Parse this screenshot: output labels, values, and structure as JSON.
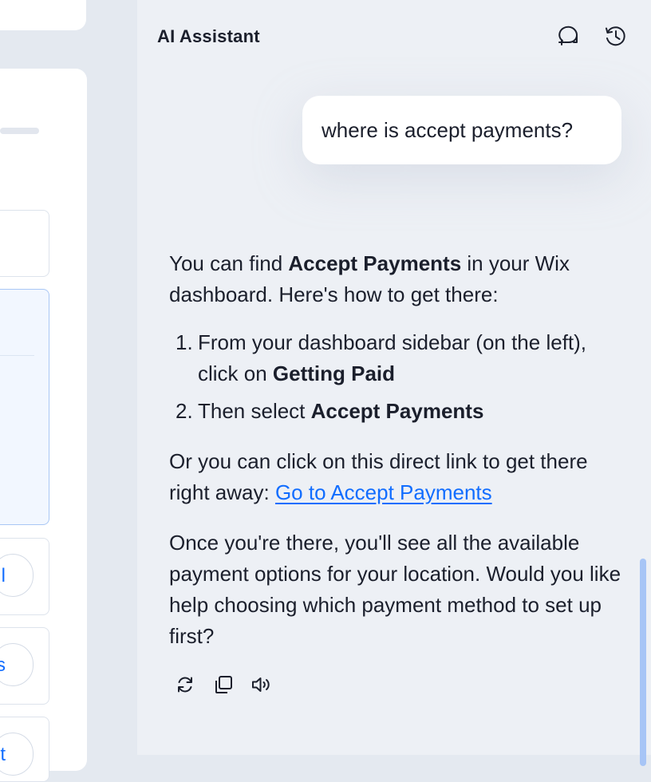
{
  "assistant": {
    "title": "AI Assistant",
    "icons": {
      "new_chat": "new-chat-icon",
      "history": "history-icon"
    }
  },
  "left_pane": {
    "pill_1_text": "l",
    "pill_2_text": "s",
    "pill_3_text": "t"
  },
  "conversation": {
    "user_message": "where is accept payments?",
    "answer": {
      "intro_before": "You can find ",
      "intro_bold": "Accept Payments",
      "intro_after": " in your Wix dashboard. Here's how to get there:",
      "steps": [
        {
          "number": "1.",
          "text": "From your dashboard sidebar (on the left), click on ",
          "bold": "Getting Paid"
        },
        {
          "number": "2.",
          "text": "Then select ",
          "bold": "Accept Payments"
        }
      ],
      "link_intro": "Or you can click on this direct link to get there right away: ",
      "link_text": "Go to Accept Payments",
      "closing": "Once you're there, you'll see all the available payment options for your location. Would you like help choosing which payment method to set up first?"
    },
    "message_actions": {
      "regenerate": "regenerate-icon",
      "copy": "copy-icon",
      "read_aloud": "speaker-icon"
    }
  },
  "colors": {
    "link": "#116dff",
    "panel_bg": "#edf0f5",
    "text": "#1b1f2c"
  }
}
